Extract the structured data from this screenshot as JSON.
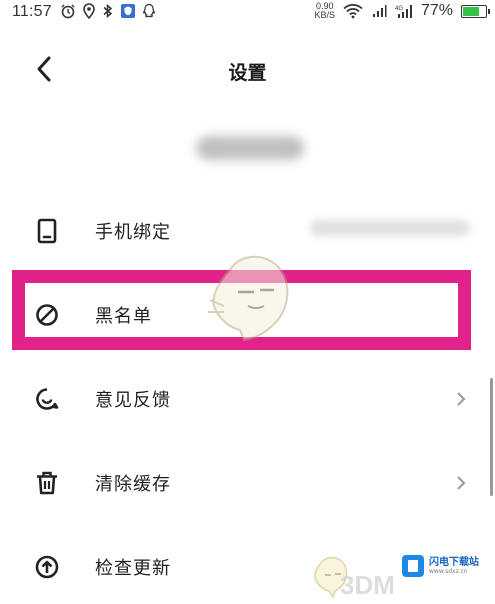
{
  "status_bar": {
    "time": "11:57",
    "net_speed_value": "0.90",
    "net_speed_unit": "KB/S",
    "battery_percent": "77%",
    "battery_level": 0.77,
    "icons": [
      "alarm-icon",
      "location-icon",
      "bluetooth-icon",
      "shield-app-icon",
      "qq-icon",
      "wifi-icon",
      "signal-icon",
      "signal-4g-icon",
      "battery-icon"
    ]
  },
  "header": {
    "title": "设置"
  },
  "menu": {
    "items": [
      {
        "label": "手机绑定",
        "icon": "phone-icon"
      },
      {
        "label": "黑名单",
        "icon": "block-icon"
      },
      {
        "label": "意见反馈",
        "icon": "feedback-icon"
      },
      {
        "label": "清除缓存",
        "icon": "trash-icon"
      },
      {
        "label": "检查更新",
        "icon": "upload-icon"
      }
    ]
  },
  "watermark": {
    "brand": "闪电下载站",
    "site": "www.sdxz.cn",
    "sub_brand": "3DM"
  },
  "colors": {
    "highlight": "#e0228a",
    "battery_fill": "#35c24a",
    "brand_blue": "#1e88e5"
  }
}
